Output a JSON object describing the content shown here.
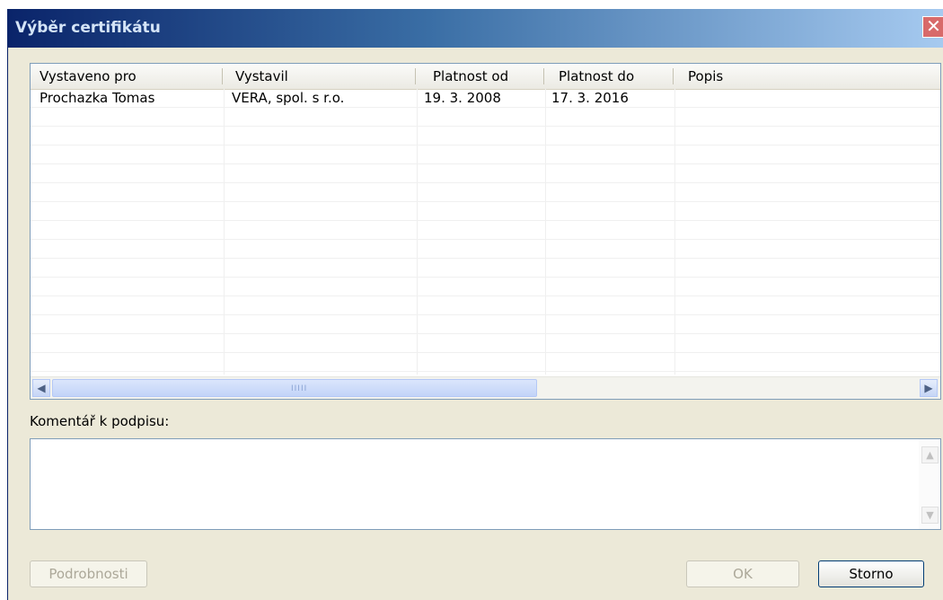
{
  "window": {
    "title": "Výběr certifikátu",
    "close_glyph": "✕"
  },
  "table": {
    "columns": [
      "Vystaveno pro",
      "Vystavil",
      "Platnost od",
      "Platnost do",
      "Popis"
    ],
    "rows": [
      [
        "Prochazka Tomas",
        "VERA, spol. s r.o.",
        "19. 3. 2008",
        "17. 3. 2016",
        ""
      ]
    ],
    "scroll_left_glyph": "◀",
    "scroll_right_glyph": "▶",
    "scroll_grip": "IIIII"
  },
  "comment": {
    "label": "Komentář k podpisu:",
    "value": "",
    "scroll_up_glyph": "▲",
    "scroll_down_glyph": "▼"
  },
  "buttons": {
    "details": "Podrobnosti",
    "ok": "OK",
    "cancel": "Storno"
  },
  "icons": {
    "close": "close-icon",
    "scroll_left": "arrow-left-icon",
    "scroll_right": "arrow-right-icon",
    "scroll_up": "arrow-up-icon",
    "scroll_down": "arrow-down-icon"
  },
  "colors": {
    "titlebar_start": "#0a246a",
    "titlebar_end": "#a6caf0",
    "dialog_bg": "#ece9d8",
    "close_button": "#d86a6a"
  }
}
